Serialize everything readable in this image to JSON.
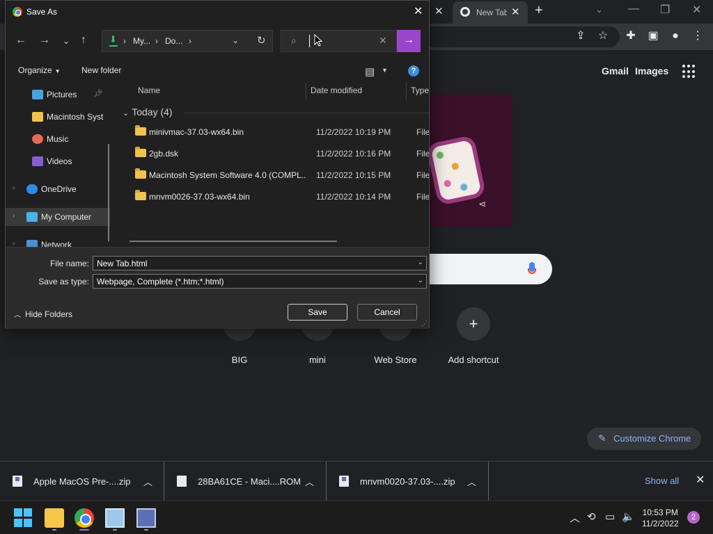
{
  "chrome": {
    "tab_title": "New Tab",
    "gmail": "Gmail",
    "images": "Images",
    "shortcuts": [
      {
        "label": "BIG"
      },
      {
        "label": "mini"
      },
      {
        "label": "Web Store"
      },
      {
        "label": "Add shortcut"
      }
    ],
    "customize": "Customize Chrome"
  },
  "downloads": {
    "items": [
      {
        "name": "Apple MacOS Pre-....zip"
      },
      {
        "name": "28BA61CE - Maci....ROM"
      },
      {
        "name": "mnvm0020-37.03-....zip"
      }
    ],
    "show_all": "Show all"
  },
  "taskbar": {
    "time": "10:53 PM",
    "date": "11/2/2022",
    "notifications": "2"
  },
  "dialog": {
    "title": "Save As",
    "breadcrumb": [
      "My...",
      "Do..."
    ],
    "search_value": "",
    "organize": "Organize",
    "new_folder": "New folder",
    "help": "?",
    "nav": [
      {
        "label": "Pictures"
      },
      {
        "label": "Macintosh Syst"
      },
      {
        "label": "Music"
      },
      {
        "label": "Videos"
      },
      {
        "label": "OneDrive"
      },
      {
        "label": "My Computer"
      },
      {
        "label": "Network"
      }
    ],
    "columns": {
      "name": "Name",
      "date": "Date modified",
      "type": "Type"
    },
    "group": "Today (4)",
    "files": [
      {
        "name": "minivmac-37.03-wx64.bin",
        "date": "11/2/2022 10:19 PM",
        "type": "File fo"
      },
      {
        "name": "2gb.dsk",
        "date": "11/2/2022 10:16 PM",
        "type": "File fo"
      },
      {
        "name": "Macintosh System Software 4.0 (COMPL...",
        "date": "11/2/2022 10:15 PM",
        "type": "File fo"
      },
      {
        "name": "mnvm0026-37.03-wx64.bin",
        "date": "11/2/2022 10:14 PM",
        "type": "File fo"
      }
    ],
    "file_name_label": "File name:",
    "file_name_value": "New Tab.html",
    "save_type_label": "Save as type:",
    "save_type_value": "Webpage, Complete (*.htm;*.html)",
    "hide_folders": "Hide Folders",
    "save_label": "Save",
    "cancel_label": "Cancel"
  }
}
